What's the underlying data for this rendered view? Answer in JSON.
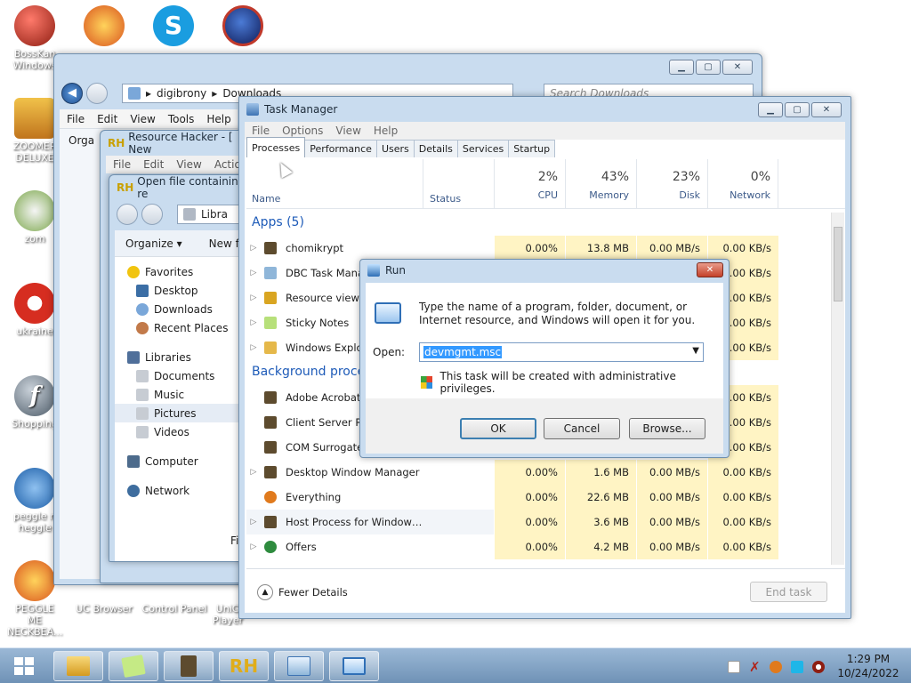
{
  "desktop_icons": [
    {
      "name": "bosskan",
      "label": "BossKan Windows",
      "color": "#c0392b"
    },
    {
      "name": "peggle-top",
      "label": "",
      "color": "#e67e22"
    },
    {
      "name": "skype",
      "label": "",
      "color": "#1a9de0"
    },
    {
      "name": "globe",
      "label": "",
      "color": "#2c3e9e"
    },
    {
      "name": "zoomer",
      "label": "ZOOMER DELUXE",
      "color": "#e8b33a"
    },
    {
      "name": "zom",
      "label": "zom",
      "color": "#6a9c3e"
    },
    {
      "name": "ukraine",
      "label": "ukraine",
      "color": "#d62d20"
    },
    {
      "name": "shopping",
      "label": "Shopping",
      "color": "#6c7a89"
    },
    {
      "name": "peggle-nights",
      "label": "peggle n heggle",
      "color": "#3d85c6"
    },
    {
      "name": "peggle-me",
      "label": "PEGGLE ME NECKBEA...",
      "color": "#e06b1d"
    },
    {
      "name": "uc-browser",
      "label": "UC Browser",
      "color": "#f08a3c"
    },
    {
      "name": "control-panel",
      "label": "Control Panel",
      "color": "#4c8cc9"
    },
    {
      "name": "unity-player",
      "label": "UniG Player",
      "color": "#8a8a8a"
    }
  ],
  "explorer": {
    "breadcrumb_1": "digibrony",
    "breadcrumb_2": "Downloads",
    "search_placeholder": "Search Downloads",
    "menu": [
      "File",
      "Edit",
      "View",
      "Tools",
      "Help"
    ],
    "organize_label": "Orga"
  },
  "resource_hacker": {
    "title": "Resource Hacker - [ New",
    "menu": [
      "File",
      "Edit",
      "View",
      "Action"
    ]
  },
  "open_dialog": {
    "title": "Open file containing re",
    "location": "Libra",
    "organize_label": "Organize ▾",
    "new_folder_label": "New f",
    "filename_label": "Fi",
    "nav": {
      "favorites": "Favorites",
      "desktop": "Desktop",
      "downloads": "Downloads",
      "recent": "Recent Places",
      "libraries": "Libraries",
      "documents": "Documents",
      "music": "Music",
      "pictures": "Pictures",
      "videos": "Videos",
      "computer": "Computer",
      "network": "Network"
    }
  },
  "task_manager": {
    "title": "Task Manager",
    "menu": [
      "File",
      "Options",
      "View",
      "Help"
    ],
    "tabs": [
      "Processes",
      "Performance",
      "Users",
      "Details",
      "Services",
      "Startup"
    ],
    "headers": {
      "name": "Name",
      "status": "Status",
      "cpu_pct": "2%",
      "cpu": "CPU",
      "mem_pct": "43%",
      "mem": "Memory",
      "disk_pct": "23%",
      "disk": "Disk",
      "net_pct": "0%",
      "net": "Network"
    },
    "groups": {
      "apps": "Apps (5)",
      "background": "Background process"
    },
    "rows": [
      {
        "name": "chomikrypt",
        "cpu": "0.00%",
        "mem": "13.8 MB",
        "disk": "0.00 MB/s",
        "net": "0.00 KB/s",
        "arrow": "▷"
      },
      {
        "name": "DBC Task Mana",
        "cpu": "",
        "mem": "",
        "disk": "",
        "net": "0.00 KB/s",
        "arrow": "▷"
      },
      {
        "name": "Resource viewe",
        "cpu": "",
        "mem": "",
        "disk": "",
        "net": "0.00 KB/s",
        "arrow": "▷"
      },
      {
        "name": "Sticky Notes",
        "cpu": "",
        "mem": "",
        "disk": "",
        "net": "0.00 KB/s",
        "arrow": "▷"
      },
      {
        "name": "Windows Explo",
        "cpu": "",
        "mem": "",
        "disk": "",
        "net": "0.00 KB/s",
        "arrow": "▷"
      },
      {
        "name": "Adobe Acrobat",
        "cpu": "",
        "mem": "",
        "disk": "",
        "net": "0.00 KB/s",
        "arrow": ""
      },
      {
        "name": "Client Server R",
        "cpu": "",
        "mem": "",
        "disk": "",
        "net": "0.00 KB/s",
        "arrow": ""
      },
      {
        "name": "COM Surrogate",
        "cpu": "",
        "mem": "",
        "disk": "",
        "net": "0.00 KB/s",
        "arrow": ""
      },
      {
        "name": "Desktop Window Manager",
        "cpu": "0.00%",
        "mem": "1.6 MB",
        "disk": "0.00 MB/s",
        "net": "0.00 KB/s",
        "arrow": "▷"
      },
      {
        "name": "Everything",
        "cpu": "0.00%",
        "mem": "22.6 MB",
        "disk": "0.00 MB/s",
        "net": "0.00 KB/s",
        "arrow": ""
      },
      {
        "name": "Host Process for Window…",
        "cpu": "0.00%",
        "mem": "3.6 MB",
        "disk": "0.00 MB/s",
        "net": "0.00 KB/s",
        "arrow": "▷"
      },
      {
        "name": "Offers",
        "cpu": "0.00%",
        "mem": "4.2 MB",
        "disk": "0.00 MB/s",
        "net": "0.00 KB/s",
        "arrow": "▷"
      }
    ],
    "fewer_details": "Fewer Details",
    "end_task": "End task"
  },
  "run_dialog": {
    "title": "Run",
    "description": "Type the name of a program, folder, document, or Internet resource, and Windows will open it for you.",
    "open_label": "Open:",
    "value": "devmgmt.msc",
    "admin_note": "This task will be created with administrative privileges.",
    "ok": "OK",
    "cancel": "Cancel",
    "browse": "Browse..."
  },
  "taskbar": {
    "time": "1:29 PM",
    "date": "10/24/2022"
  },
  "colors": {
    "accent_blue": "#1e5bb8",
    "heat_yellow": "#fff4c4",
    "run_selection": "#3399ff"
  }
}
